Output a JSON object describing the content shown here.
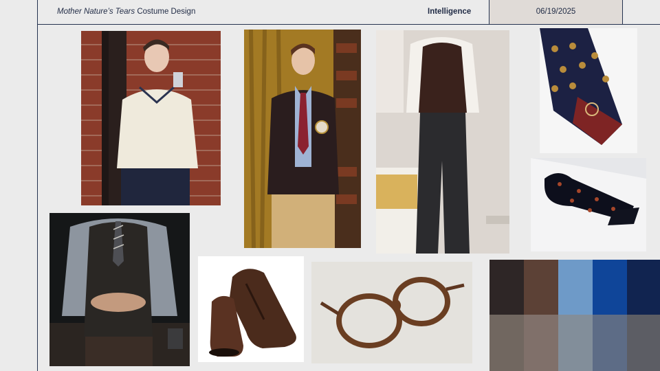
{
  "header": {
    "title_italic": "Mother Nature’s Tears",
    "title_rest": " Costume Design",
    "section": "Intelligence",
    "date": "06/19/2025"
  },
  "palette": {
    "top_row": [
      "#2e2626",
      "#5c4136",
      "#6e9ac8",
      "#0f4599",
      "#112450"
    ],
    "bottom_row": [
      "#716760",
      "#80706a",
      "#828e9a",
      "#5d6c86",
      "#5c5d64"
    ]
  },
  "colors": {
    "background": "#ebebeb",
    "rule": "#24324f",
    "date_box": "#e0dbd7"
  }
}
